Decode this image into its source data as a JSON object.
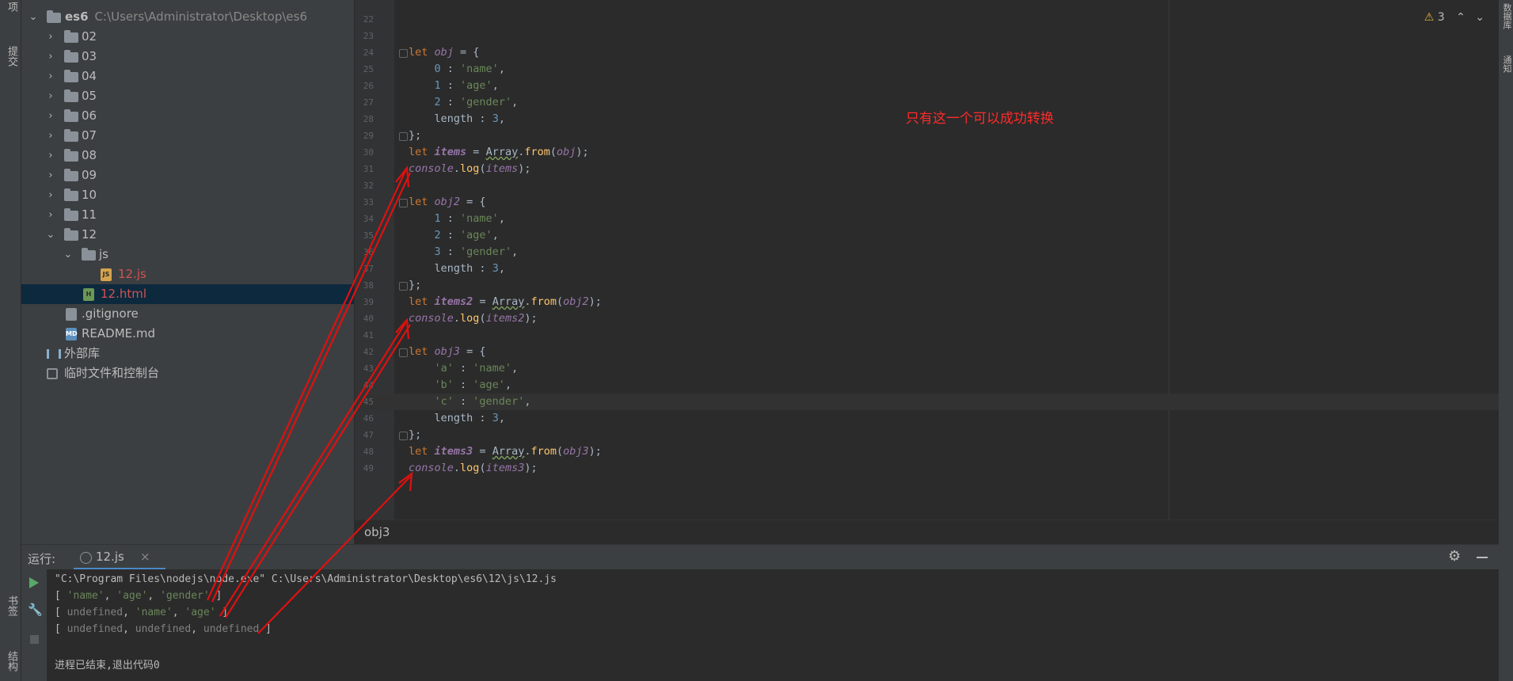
{
  "left_strip": {
    "top_label": "项",
    "commit_label": "提交",
    "bookmarks_label": "书签",
    "structure_label": "结构"
  },
  "right_strip": {
    "database_label": "数据库",
    "notifications_label": "通知"
  },
  "project": {
    "root": {
      "name": "es6",
      "path": "C:\\Users\\Administrator\\Desktop\\es6"
    },
    "folders": [
      "02",
      "03",
      "04",
      "05",
      "06",
      "07",
      "08",
      "09",
      "10",
      "11"
    ],
    "folder_12": "12",
    "folder_js": "js",
    "file_js": "12.js",
    "file_html": "12.html",
    "file_gitignore": ".gitignore",
    "file_readme": "README.md",
    "external_libs": "外部库",
    "scratches": "临时文件和控制台",
    "icon_js": "JS",
    "icon_html": "H",
    "icon_md": "MD"
  },
  "editor": {
    "annotation": "只有这一个可以成功转换",
    "warning_count": "3",
    "breadcrumb": "obj3",
    "line_numbers": [
      "22",
      "23",
      "24",
      "25",
      "26",
      "27",
      "28",
      "29",
      "30",
      "31",
      "32",
      "33",
      "34",
      "35",
      "36",
      "37",
      "38",
      "39",
      "40",
      "41",
      "42",
      "43",
      "44",
      "45",
      "46",
      "47",
      "48",
      "49"
    ],
    "code": {
      "kw_let": "let",
      "obj": "obj",
      "obj2": "obj2",
      "obj3": "obj3",
      "items": "items",
      "items2": "items2",
      "items3": "items3",
      "assign_open": " = {",
      "close": "};",
      "key0": "0",
      "key1": "1",
      "key2": "2",
      "key3": "3",
      "key_a": "'a'",
      "key_b": "'b'",
      "key_c": "'c'",
      "colon": " : ",
      "val_name": "'name'",
      "val_age": "'age'",
      "val_gender": "'gender'",
      "comma": ",",
      "length": "length",
      "num3": "3",
      "eq": " = ",
      "array": "Array",
      "dot": ".",
      "from": "from",
      "lparen": "(",
      "rparen_semi": ");",
      "console": "console",
      "log": "log"
    }
  },
  "run": {
    "label": "运行:",
    "tab": "12.js",
    "tab_close": "×",
    "cmd": "\"C:\\Program Files\\nodejs\\node.exe\" C:\\Users\\Administrator\\Desktop\\es6\\12\\js\\12.js",
    "out_open": "[ ",
    "out_close": " ]",
    "sep": ", ",
    "undefined": "undefined",
    "s_name": "'name'",
    "s_age": "'age'",
    "s_gender": "'gender'",
    "exit": "进程已结束,退出代码0"
  },
  "colors": {
    "annotation": "#ff2a2a",
    "keyword": "#cc7832",
    "string": "#6a8759",
    "number": "#6897bb",
    "variable": "#9876aa"
  }
}
